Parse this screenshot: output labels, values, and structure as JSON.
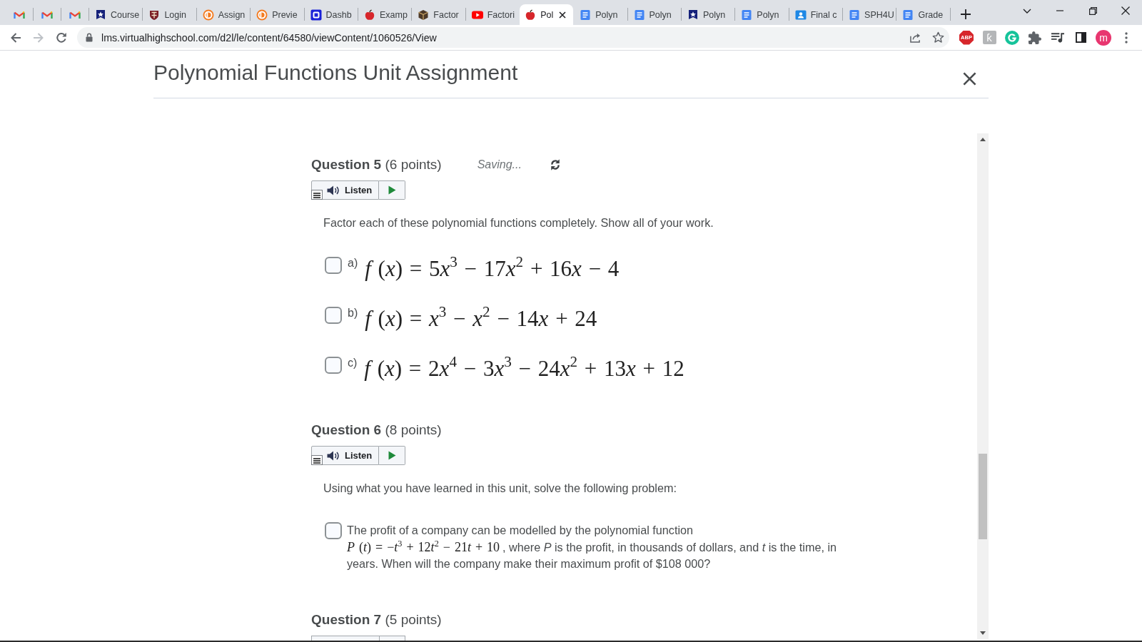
{
  "browser": {
    "tabs": [
      {
        "kind": "mail",
        "selected": false
      },
      {
        "kind": "mail",
        "selected": false
      },
      {
        "kind": "mail",
        "selected": false
      },
      {
        "kind": "shield",
        "label": "Course",
        "selected": false
      },
      {
        "kind": "crest",
        "label": "Login",
        "selected": false
      },
      {
        "kind": "ring",
        "label": "Assign",
        "selected": false
      },
      {
        "kind": "ring",
        "label": "Previe",
        "selected": false
      },
      {
        "kind": "square",
        "label": "Dashb",
        "selected": false
      },
      {
        "kind": "apple",
        "label": "Examp",
        "selected": false
      },
      {
        "kind": "cube",
        "label": "Factor",
        "selected": false
      },
      {
        "kind": "video",
        "label": "Factori",
        "selected": false
      },
      {
        "kind": "apple",
        "label": "Pol",
        "selected": true
      },
      {
        "kind": "doc",
        "label": "Polyn",
        "selected": false
      },
      {
        "kind": "doc",
        "label": "Polyn",
        "selected": false
      },
      {
        "kind": "shield",
        "label": "Polyn",
        "selected": false
      },
      {
        "kind": "doc",
        "label": "Polyn",
        "selected": false
      },
      {
        "kind": "person",
        "label": "Final c",
        "selected": false
      },
      {
        "kind": "doc",
        "label": "SPH4U",
        "selected": false
      },
      {
        "kind": "doc",
        "label": "Grade",
        "selected": false
      }
    ],
    "forward": {
      "disabled": true
    },
    "url": "lms.virtualhighschool.com/d2l/le/content/64580/viewContent/1060526/View",
    "extensions": [
      {
        "kind": "abp",
        "label": "ABP"
      },
      {
        "kind": "tile",
        "label": "ƙ"
      },
      {
        "kind": "ring"
      },
      {
        "kind": "puzzle"
      },
      {
        "kind": "playlist"
      },
      {
        "kind": "panel"
      }
    ],
    "profile": {
      "initial": "m"
    }
  },
  "page": {
    "title": "Polynomial Functions Unit Assignment",
    "questions": [
      {
        "heading": "**Question 5** (6 points)",
        "status": "Saving...",
        "listen": {
          "label": "Listen"
        },
        "prompt": "Factor each of these polynomial functions completely. Show all of your work.",
        "items": [
          {
            "kind": "formula",
            "letter": "a)",
            "math": "f (x) = 5x$^{3}$ − 17x$^{2}$ + 16x − 4",
            "checked": false
          },
          {
            "kind": "formula",
            "letter": "b)",
            "math": "f (x) = x$^{3}$ − x$^{2}$ − 14x + 24",
            "checked": false
          },
          {
            "kind": "formula",
            "letter": "c)",
            "math": "f (x) = 2x$^{4}$ − 3x$^{3}$ − 24x$^{2}$ + 13x + 12",
            "checked": false
          }
        ]
      },
      {
        "heading": "**Question 6** (8 points)",
        "listen": {
          "label": "Listen"
        },
        "prompt": "Using what you have learned in this unit, solve the following problem:",
        "items": [
          {
            "kind": "paragraph",
            "text": "The profit of a company can be modelled by the polynomial function",
            "math": "P (t) = −t$^{3}$ + 12t$^{2}$ − 21t + 10",
            "text_after": ", where *P* is the profit, in thousands of dollars, and *t* is the time, in years. When will the company make their maximum profit of $108 000?",
            "checked": false
          }
        ]
      },
      {
        "heading": "**Question 7** (5 points)",
        "listen": {
          "cut": true
        }
      }
    ]
  }
}
